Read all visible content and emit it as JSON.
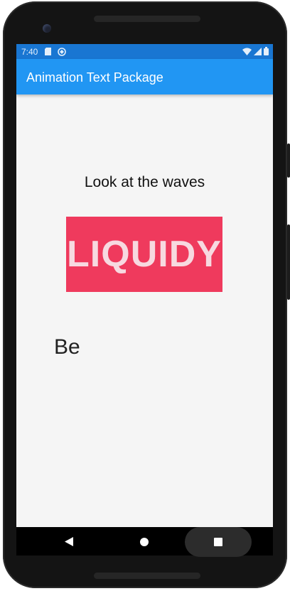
{
  "status_bar": {
    "time": "7:40",
    "left_icons": [
      "sd-card-icon",
      "sync-icon"
    ],
    "right_icons": [
      "wifi-icon",
      "cell-signal-icon",
      "battery-icon"
    ]
  },
  "app_bar": {
    "title": "Animation Text Package",
    "color": "#2196f3"
  },
  "content": {
    "wave_caption": "Look at the waves",
    "liquid_text": "LIQUIDY",
    "liquid_box_color": "#ef3a5d",
    "typer_text": "Be"
  },
  "nav_bar": {
    "buttons": [
      "back-icon",
      "home-icon",
      "recents-icon"
    ]
  }
}
